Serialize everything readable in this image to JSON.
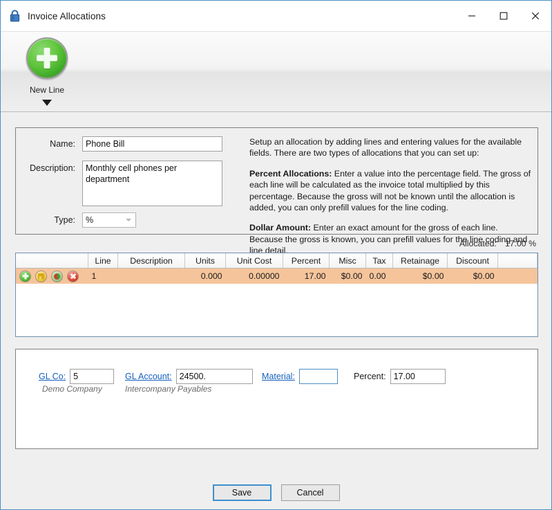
{
  "window": {
    "title": "Invoice Allocations",
    "lock_icon": "lock-icon",
    "minimize": "—",
    "maximize": "☐",
    "close": "✕"
  },
  "toolbar": {
    "new_line_label": "New Line",
    "new_line_icon": "green-plus-circle-icon",
    "dropdown_icon": "caret-down-icon"
  },
  "header_panel": {
    "name_label": "Name:",
    "name_value": "Phone Bill",
    "description_label": "Description:",
    "description_value": "Monthly cell phones per department",
    "type_label": "Type:",
    "type_value": "%",
    "type_options": [
      "%",
      "$"
    ]
  },
  "help": {
    "intro": "Setup an allocation by adding lines and entering values for the available fields. There are two types of allocations that you can set up:",
    "percent_title": "Percent Allocations:",
    "percent_body": " Enter a value into the percentage field. The gross of each line will be calculated as the invoice total multiplied by this percentage. Because the gross will not be known until the allocation is added, you can only prefill values for the line coding.",
    "dollar_title": "Dollar Amount:",
    "dollar_body": " Enter an exact amount for the gross of each line. Because the gross is known, you can prefill values for the line coding and line detail."
  },
  "allocated": {
    "label": "Allocated:",
    "value": "17.00 %"
  },
  "grid": {
    "columns": [
      "Line",
      "Description",
      "Units",
      "Unit Cost",
      "Percent",
      "Misc",
      "Tax",
      "Retainage",
      "Discount"
    ],
    "row_icons": [
      "add-row-icon",
      "save-row-icon",
      "refresh-row-icon",
      "delete-row-icon"
    ],
    "rows": [
      {
        "line": "1",
        "description": "",
        "units": "0.000",
        "unit_cost": "0.00000",
        "percent": "17.00",
        "misc": "$0.00",
        "tax": "0.00",
        "retainage": "$0.00",
        "discount": "$0.00"
      }
    ]
  },
  "coding": {
    "gl_co_label": "GL Co:",
    "gl_co_value": "5",
    "gl_co_desc": "Demo Company",
    "gl_account_label": "GL Account:",
    "gl_account_value": "24500.",
    "gl_account_desc": "Intercompany Payables",
    "material_label": "Material:",
    "material_value": "",
    "percent_label": "Percent:",
    "percent_value": "17.00"
  },
  "footer": {
    "save_label": "Save",
    "cancel_label": "Cancel"
  },
  "colors": {
    "accent": "#4a90c4",
    "selected_row": "#f5c49b",
    "link": "#1560bd"
  }
}
